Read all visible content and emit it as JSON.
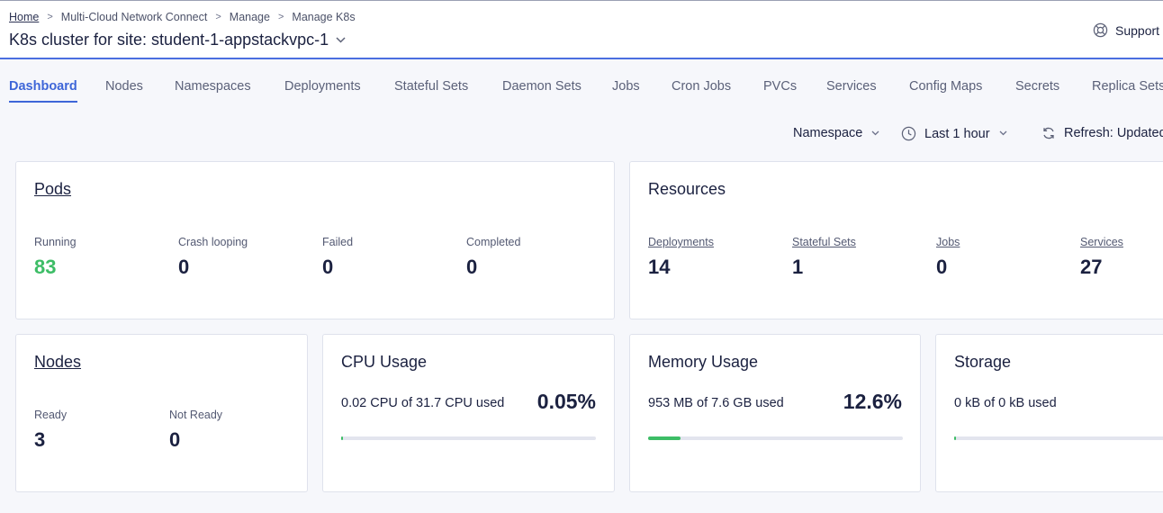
{
  "breadcrumb": {
    "items": [
      "Home",
      "Multi-Cloud Network Connect",
      "Manage",
      "Manage K8s"
    ]
  },
  "page": {
    "title": "K8s cluster for site: student-1-appstackvpc-1"
  },
  "support": {
    "label": "Support"
  },
  "tabs": [
    {
      "label": "Dashboard",
      "active": true
    },
    {
      "label": "Nodes"
    },
    {
      "label": "Namespaces"
    },
    {
      "label": "Deployments"
    },
    {
      "label": "Stateful Sets"
    },
    {
      "label": "Daemon Sets"
    },
    {
      "label": "Jobs"
    },
    {
      "label": "Cron Jobs"
    },
    {
      "label": "PVCs"
    },
    {
      "label": "Services"
    },
    {
      "label": "Config Maps"
    },
    {
      "label": "Secrets"
    },
    {
      "label": "Replica Sets"
    }
  ],
  "toolbar": {
    "namespace_label": "Namespace",
    "time_label": "Last 1 hour",
    "refresh_label": "Refresh: Updated"
  },
  "pods": {
    "title": "Pods",
    "stats": [
      {
        "label": "Running",
        "value": "83"
      },
      {
        "label": "Crash looping",
        "value": "0"
      },
      {
        "label": "Failed",
        "value": "0"
      },
      {
        "label": "Completed",
        "value": "0"
      }
    ]
  },
  "resources": {
    "title": "Resources",
    "stats": [
      {
        "label": "Deployments",
        "value": "14"
      },
      {
        "label": "Stateful Sets",
        "value": "1"
      },
      {
        "label": "Jobs",
        "value": "0"
      },
      {
        "label": "Services",
        "value": "27"
      }
    ]
  },
  "nodes": {
    "title": "Nodes",
    "stats": [
      {
        "label": "Ready",
        "value": "3"
      },
      {
        "label": "Not Ready",
        "value": "0"
      }
    ]
  },
  "cpu": {
    "title": "CPU Usage",
    "text": "0.02 CPU of 31.7 CPU used",
    "percent_label": "0.05%",
    "fraction": 0.0005
  },
  "memory": {
    "title": "Memory Usage",
    "text": "953 MB of 7.6 GB used",
    "percent_label": "12.6%",
    "fraction": 0.126
  },
  "storage": {
    "title": "Storage",
    "text": "0 kB of 0 kB used",
    "fraction": 0
  },
  "colors": {
    "accent": "#3e66d8",
    "success": "#3dbd66"
  }
}
